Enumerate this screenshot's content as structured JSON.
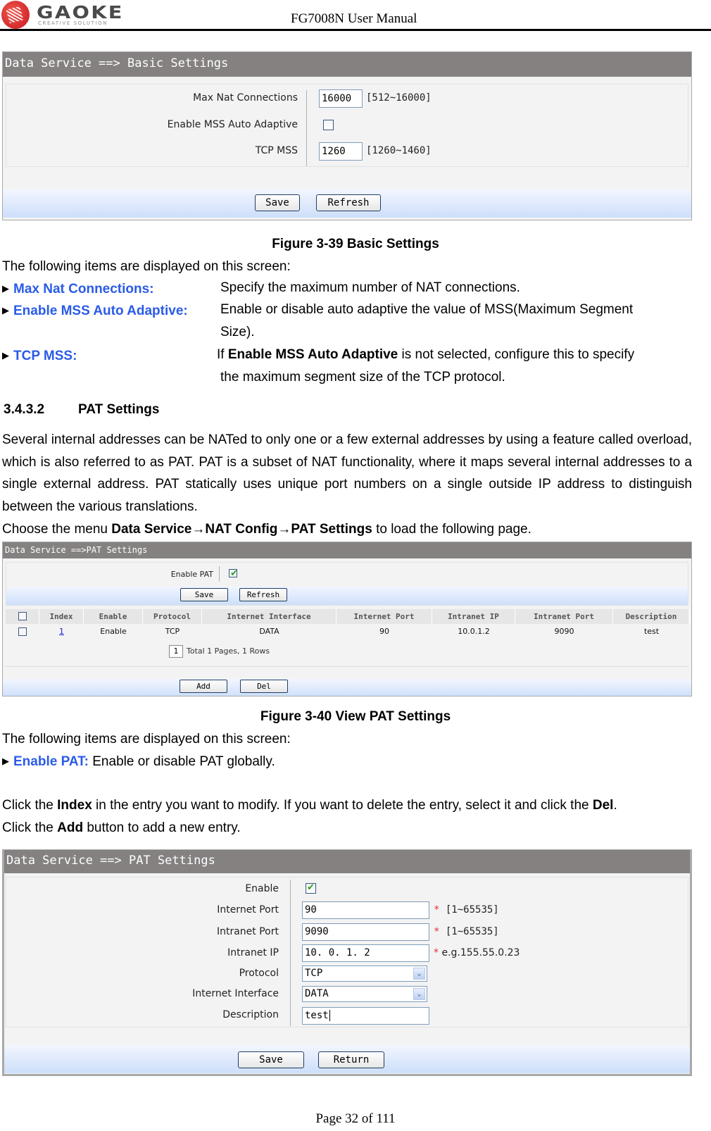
{
  "header": {
    "logo_word": "GAOKE",
    "logo_tagline": "CREATIVE SOLUTION",
    "manual_title": "FG7008N User Manual"
  },
  "fig39": {
    "title": "Data Service ==> Basic Settings",
    "fields": [
      {
        "label": "Max Nat Connections",
        "value": "16000",
        "hint": "[512~16000]"
      },
      {
        "label": "Enable MSS Auto Adaptive",
        "checked": false
      },
      {
        "label": "TCP MSS",
        "value": "1260",
        "hint": "[1260~1460]"
      }
    ],
    "buttons": {
      "save": "Save",
      "refresh": "Refresh"
    },
    "caption": "Figure 3-39  Basic Settings"
  },
  "desc39": {
    "intro": "The following items are displayed on this screen:",
    "items": [
      {
        "term": "Max Nat Connections:",
        "text": "Specify the maximum number of NAT connections."
      },
      {
        "term": "Enable MSS Auto Adaptive:",
        "text": "Enable or disable auto adaptive the value of MSS(Maximum Segment",
        "text2": "Size)."
      },
      {
        "term": "TCP MSS:",
        "text_pre": "If ",
        "text_bold": "Enable MSS Auto Adaptive",
        "text_post": " is not selected, configure this to specify",
        "text2": "the maximum segment size of the TCP protocol."
      }
    ]
  },
  "section": {
    "number": "3.4.3.2",
    "title": "PAT Settings",
    "paragraph": "Several internal addresses can be NATed to only one or a few external addresses by using a feature called overload, which is also referred to as PAT. PAT is a subset of NAT functionality, where it maps several internal addresses to a single external address. PAT statically uses unique port numbers on a single outside IP address to distinguish between the various translations.",
    "menu_pre": "Choose the menu ",
    "menu_path": "Data Service→NAT Config→PAT Settings",
    "menu_post": " to load the following page."
  },
  "fig40": {
    "title": "Data Service ==>PAT Settings",
    "enable_pat_label": "Enable PAT",
    "enable_pat_checked": true,
    "buttons": {
      "save": "Save",
      "refresh": "Refresh",
      "add": "Add",
      "del": "Del"
    },
    "table": {
      "columns": [
        "Index",
        "Enable",
        "Protocol",
        "Internet Interface",
        "Internet Port",
        "Intranet IP",
        "Intranet Port",
        "Description"
      ],
      "rows": [
        {
          "index": "1",
          "enable": "Enable",
          "protocol": "TCP",
          "interface": "DATA",
          "internet_port": "90",
          "intranet_ip": "10.0.1.2",
          "intranet_port": "9090",
          "description": "test"
        }
      ]
    },
    "pager": {
      "current": "1",
      "summary": "Total 1 Pages, 1 Rows"
    },
    "caption": "Figure 3-40  View PAT Settings"
  },
  "desc40": {
    "intro": "The following items are displayed on this screen:",
    "items": [
      {
        "term": "Enable PAT:",
        "text": " Enable or disable PAT globally."
      }
    ],
    "line1_pre": "Click the ",
    "line1_b1": "Index",
    "line1_mid": " in the entry you want to modify. If you want to delete the entry, select it and click the ",
    "line1_b2": "Del",
    "line1_post": ".",
    "line2_pre": "Click the ",
    "line2_b": "Add",
    "line2_post": " button to add a new entry."
  },
  "figEdit": {
    "title": "Data Service ==> PAT Settings",
    "fields": [
      {
        "label": "Enable",
        "checked": true
      },
      {
        "label": "Internet Port",
        "value": "90",
        "hint": "[1~65535]"
      },
      {
        "label": "Intranet Port",
        "value": "9090",
        "hint": "[1~65535]"
      },
      {
        "label": "Intranet IP",
        "value": "10. 0. 1. 2",
        "hint": "e.g.155.55.0.23"
      },
      {
        "label": "Protocol",
        "value": "TCP"
      },
      {
        "label": "Internet Interface",
        "value": "DATA"
      },
      {
        "label": "Description",
        "value": "test"
      }
    ],
    "required_mark": "*",
    "buttons": {
      "save": "Save",
      "return": "Return"
    }
  },
  "footer": {
    "page": "Page 32 of 111"
  },
  "icons": {
    "bullet": "▶",
    "dropdown": "⌄"
  }
}
